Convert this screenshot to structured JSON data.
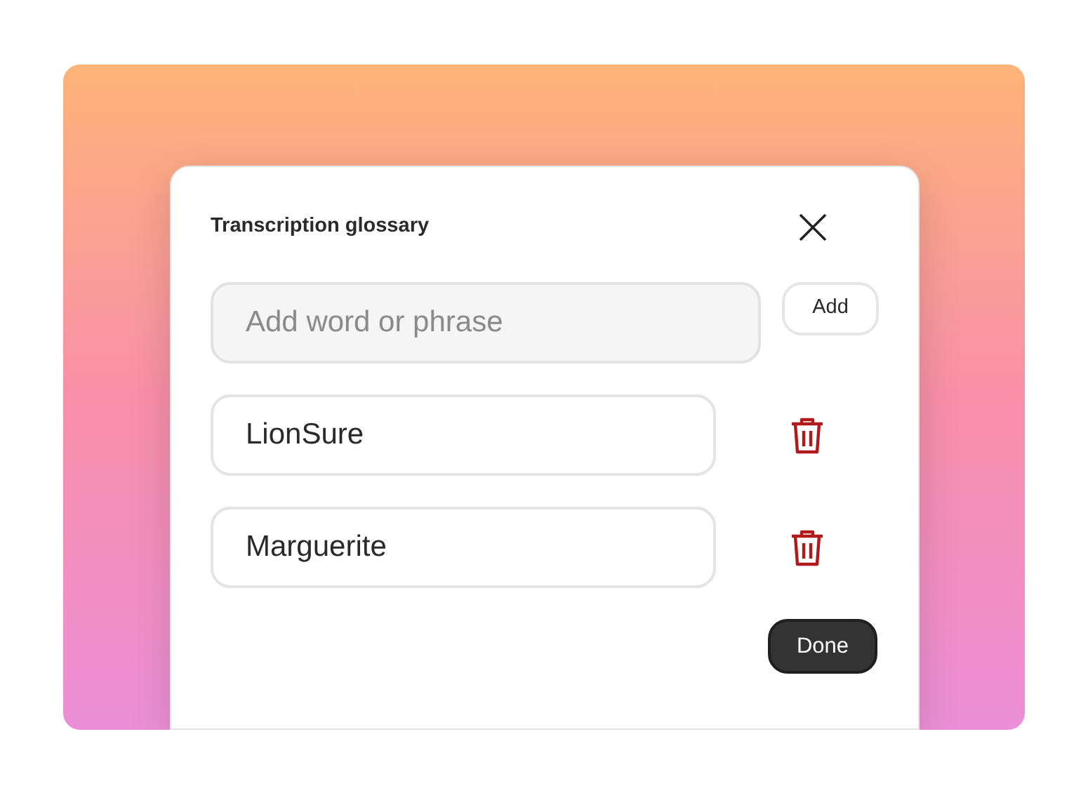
{
  "dialog": {
    "title": "Transcription glossary",
    "new_entry": {
      "placeholder": "Add word or phrase"
    },
    "add_button": "Add",
    "entries": [
      {
        "value": "LionSure"
      },
      {
        "value": "Marguerite"
      }
    ],
    "done_button": "Done"
  }
}
